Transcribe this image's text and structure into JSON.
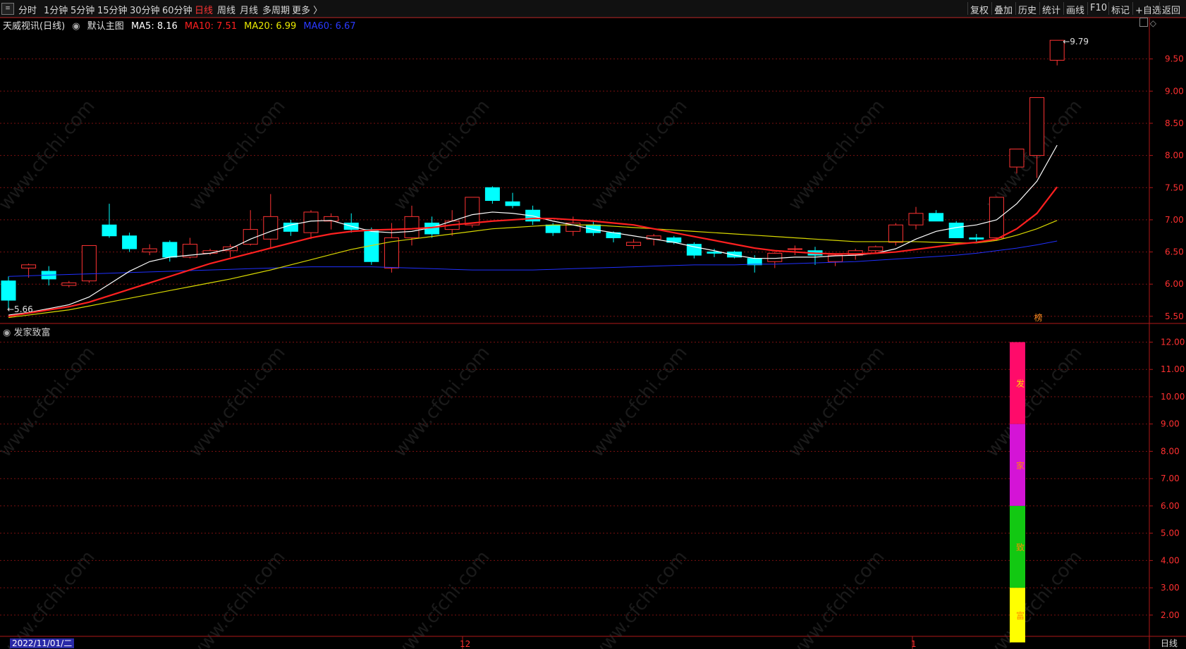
{
  "toolbar": {
    "periods": [
      "分时",
      "1分钟",
      "5分钟",
      "15分钟",
      "30分钟",
      "60分钟",
      "日线",
      "周线",
      "月线",
      "多周期",
      "更多 〉"
    ],
    "active_period": "日线",
    "actions": [
      "复权",
      "叠加",
      "历史",
      "统计",
      "画线",
      "F10",
      "标记",
      "+自选",
      "返回"
    ]
  },
  "legend": {
    "title": "天威视讯(日线)",
    "template": "默认主图",
    "ma5": "MA5: 8.16",
    "ma10": "MA10: 7.51",
    "ma20": "MA20: 6.99",
    "ma60": "MA60: 6.67"
  },
  "indicator": {
    "title": "发家致富",
    "chars": [
      "发",
      "家",
      "致",
      "富"
    ]
  },
  "price_marks": {
    "high": "9.79",
    "low": "5.66",
    "tag": "榜"
  },
  "xaxis": {
    "date": "2022/11/01/二",
    "month_12": "12",
    "month_1": "1",
    "period": "日线"
  },
  "watermark": "www.cfchi.com",
  "colors": {
    "up": "#ff3333",
    "down": "#00ffff",
    "ma5": "#ffffff",
    "ma10": "#ff2020",
    "ma20": "#d8d800",
    "ma60": "#2030ff",
    "grid": "#7a1010"
  },
  "chart_data": [
    {
      "type": "candlestick",
      "title": "天威视讯(日线)",
      "ylim": [
        5.4,
        10.0
      ],
      "yticks": [
        5.5,
        6.0,
        6.5,
        7.0,
        7.5,
        8.0,
        8.5,
        9.0,
        9.5
      ],
      "ohlc": [
        [
          6.05,
          6.12,
          5.62,
          5.75
        ],
        [
          6.25,
          6.32,
          6.1,
          6.3
        ],
        [
          6.2,
          6.28,
          5.98,
          6.08
        ],
        [
          5.98,
          6.05,
          5.95,
          6.02
        ],
        [
          6.05,
          6.6,
          6.02,
          6.6
        ],
        [
          6.92,
          7.25,
          6.72,
          6.75
        ],
        [
          6.75,
          6.8,
          6.5,
          6.55
        ],
        [
          6.5,
          6.62,
          6.45,
          6.55
        ],
        [
          6.65,
          6.68,
          6.35,
          6.42
        ],
        [
          6.42,
          6.72,
          6.4,
          6.62
        ],
        [
          6.48,
          6.55,
          6.45,
          6.52
        ],
        [
          6.52,
          6.62,
          6.42,
          6.58
        ],
        [
          6.62,
          7.15,
          6.6,
          6.85
        ],
        [
          6.7,
          7.4,
          6.55,
          7.05
        ],
        [
          6.95,
          7.0,
          6.75,
          6.82
        ],
        [
          6.8,
          7.15,
          6.7,
          7.12
        ],
        [
          6.98,
          7.1,
          6.85,
          7.05
        ],
        [
          6.95,
          7.1,
          6.8,
          6.85
        ],
        [
          6.85,
          6.88,
          6.3,
          6.35
        ],
        [
          6.25,
          6.95,
          6.18,
          6.72
        ],
        [
          6.72,
          7.22,
          6.6,
          7.05
        ],
        [
          6.95,
          7.05,
          6.72,
          6.78
        ],
        [
          6.85,
          7.15,
          6.75,
          6.98
        ],
        [
          6.92,
          7.35,
          6.88,
          7.35
        ],
        [
          7.5,
          7.52,
          7.25,
          7.3
        ],
        [
          7.28,
          7.42,
          7.18,
          7.22
        ],
        [
          7.15,
          7.22,
          6.92,
          6.98
        ],
        [
          6.92,
          6.95,
          6.75,
          6.8
        ],
        [
          6.82,
          7.05,
          6.75,
          6.95
        ],
        [
          6.92,
          6.98,
          6.75,
          6.8
        ],
        [
          6.8,
          6.82,
          6.65,
          6.72
        ],
        [
          6.6,
          6.7,
          6.55,
          6.65
        ],
        [
          6.7,
          6.78,
          6.6,
          6.75
        ],
        [
          6.72,
          6.75,
          6.62,
          6.65
        ],
        [
          6.62,
          6.65,
          6.4,
          6.45
        ],
        [
          6.5,
          6.55,
          6.42,
          6.48
        ],
        [
          6.5,
          6.52,
          6.4,
          6.42
        ],
        [
          6.4,
          6.45,
          6.18,
          6.3
        ],
        [
          6.35,
          6.5,
          6.25,
          6.48
        ],
        [
          6.55,
          6.6,
          6.45,
          6.55
        ],
        [
          6.52,
          6.58,
          6.3,
          6.45
        ],
        [
          6.35,
          6.48,
          6.28,
          6.45
        ],
        [
          6.45,
          6.55,
          6.38,
          6.52
        ],
        [
          6.52,
          6.6,
          6.48,
          6.58
        ],
        [
          6.65,
          6.95,
          6.6,
          6.92
        ],
        [
          6.92,
          7.2,
          6.85,
          7.1
        ],
        [
          7.1,
          7.15,
          6.98,
          6.98
        ],
        [
          6.95,
          6.98,
          6.72,
          6.72
        ],
        [
          6.72,
          6.78,
          6.65,
          6.7
        ],
        [
          6.72,
          7.35,
          6.68,
          7.35
        ],
        [
          7.82,
          8.1,
          7.72,
          8.1
        ],
        [
          8.0,
          8.9,
          7.65,
          8.9
        ],
        [
          9.48,
          9.79,
          9.4,
          9.79
        ]
      ],
      "ma5": [
        5.52,
        5.56,
        5.62,
        5.68,
        5.8,
        6.0,
        6.2,
        6.35,
        6.42,
        6.45,
        6.48,
        6.55,
        6.7,
        6.82,
        6.92,
        6.98,
        6.99,
        6.9,
        6.82,
        6.8,
        6.82,
        6.88,
        6.98,
        7.08,
        7.12,
        7.1,
        7.06,
        6.98,
        6.92,
        6.85,
        6.8,
        6.75,
        6.7,
        6.65,
        6.58,
        6.52,
        6.45,
        6.4,
        6.4,
        6.42,
        6.42,
        6.44,
        6.45,
        6.48,
        6.55,
        6.7,
        6.82,
        6.88,
        6.92,
        7.0,
        7.25,
        7.6,
        8.16
      ],
      "ma10": [
        5.5,
        5.55,
        5.6,
        5.65,
        5.72,
        5.82,
        5.92,
        6.02,
        6.12,
        6.22,
        6.32,
        6.4,
        6.48,
        6.56,
        6.64,
        6.72,
        6.78,
        6.82,
        6.84,
        6.85,
        6.86,
        6.88,
        6.92,
        6.95,
        6.98,
        7.0,
        7.02,
        7.02,
        7.0,
        6.98,
        6.95,
        6.92,
        6.86,
        6.8,
        6.74,
        6.68,
        6.62,
        6.56,
        6.52,
        6.5,
        6.48,
        6.47,
        6.47,
        6.48,
        6.5,
        6.54,
        6.58,
        6.62,
        6.65,
        6.7,
        6.86,
        7.1,
        7.51
      ],
      "ma20": [
        5.48,
        5.52,
        5.56,
        5.6,
        5.66,
        5.72,
        5.78,
        5.84,
        5.9,
        5.96,
        6.02,
        6.08,
        6.15,
        6.22,
        6.3,
        6.38,
        6.46,
        6.54,
        6.6,
        6.66,
        6.7,
        6.74,
        6.78,
        6.82,
        6.86,
        6.88,
        6.9,
        6.92,
        6.92,
        6.92,
        6.9,
        6.88,
        6.86,
        6.84,
        6.82,
        6.8,
        6.78,
        6.76,
        6.74,
        6.72,
        6.7,
        6.68,
        6.66,
        6.66,
        6.66,
        6.66,
        6.65,
        6.64,
        6.64,
        6.68,
        6.76,
        6.86,
        6.99
      ],
      "ma60": [
        6.12,
        6.13,
        6.14,
        6.15,
        6.16,
        6.17,
        6.18,
        6.19,
        6.2,
        6.21,
        6.22,
        6.23,
        6.24,
        6.25,
        6.26,
        6.27,
        6.27,
        6.27,
        6.27,
        6.26,
        6.25,
        6.24,
        6.23,
        6.22,
        6.22,
        6.22,
        6.22,
        6.23,
        6.24,
        6.25,
        6.26,
        6.27,
        6.28,
        6.29,
        6.3,
        6.3,
        6.3,
        6.31,
        6.31,
        6.32,
        6.33,
        6.34,
        6.35,
        6.37,
        6.39,
        6.41,
        6.43,
        6.45,
        6.48,
        6.52,
        6.56,
        6.61,
        6.67
      ]
    },
    {
      "type": "bar",
      "title": "发家致富",
      "ylim": [
        1.3,
        12.4
      ],
      "yticks": [
        2.0,
        3.0,
        4.0,
        5.0,
        6.0,
        7.0,
        8.0,
        9.0,
        10.0,
        11.0,
        12.0
      ],
      "segments": [
        {
          "label": "发",
          "from": 9.0,
          "to": 12.0,
          "color": "#ff0b6a"
        },
        {
          "label": "家",
          "from": 6.0,
          "to": 9.0,
          "color": "#d414d6"
        },
        {
          "label": "致",
          "from": 3.0,
          "to": 6.0,
          "color": "#12c812"
        },
        {
          "label": "富",
          "from": 1.0,
          "to": 3.0,
          "color": "#ffff00"
        }
      ]
    }
  ]
}
